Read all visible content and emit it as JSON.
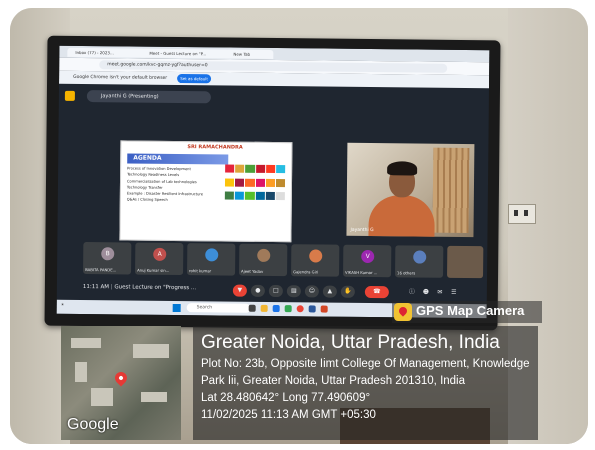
{
  "browser": {
    "tabs": [
      "Inbox (77) - 2023...",
      "Meet - Guest Lecture on \"P...",
      "New Tab"
    ],
    "url": "meet.google.com/kvc-gqmz-ygf?authuser=0",
    "notice": "Google Chrome isn't your default browser",
    "set_default": "Set as default"
  },
  "meet": {
    "presenter": "Jayanthi G (Presenting)",
    "speaker_label": "Jayanthi G",
    "meeting_time": "11:11 AM",
    "meeting_title": "Guest Lecture on \"Progress ...",
    "participants": [
      "BABITA PANDE...",
      "Anuj Kumar sin...",
      "rohit kumar",
      "Ajeet Yadav",
      "Gajendra Giri",
      "VIKASH Kumar ...",
      "16 others"
    ],
    "participant_initials": [
      "B",
      "A",
      "",
      "",
      "",
      "V",
      ""
    ]
  },
  "slide": {
    "logo": "SRI RAMACHANDRA",
    "heading": "AGENDA",
    "items": [
      "Process of Innovation Development",
      "Technology Readiness Levels",
      "Commercialization of Lab technologies",
      "Technology Transfer",
      "Example : Disaster Resilient Infrastructure",
      "Q&As / Closing Speech"
    ]
  },
  "taskbar": {
    "search": "Search"
  },
  "gps": {
    "brand": "GPS Map Camera",
    "map_logo": "Google",
    "city": "Greater Noida, Uttar Pradesh, India",
    "address_line1": "Plot No: 23b, Opposite Iimt College Of Management, Knowledge",
    "address_line2": "Park Iii, Greater Noida, Uttar Pradesh 201310, India",
    "coords": "Lat 28.480642° Long 77.490609°",
    "datetime": "11/02/2025 11:13 AM GMT +05:30"
  },
  "colors": {
    "end_call": "#ea4335",
    "set_default": "#1a73e8",
    "pin": "#e53935"
  }
}
